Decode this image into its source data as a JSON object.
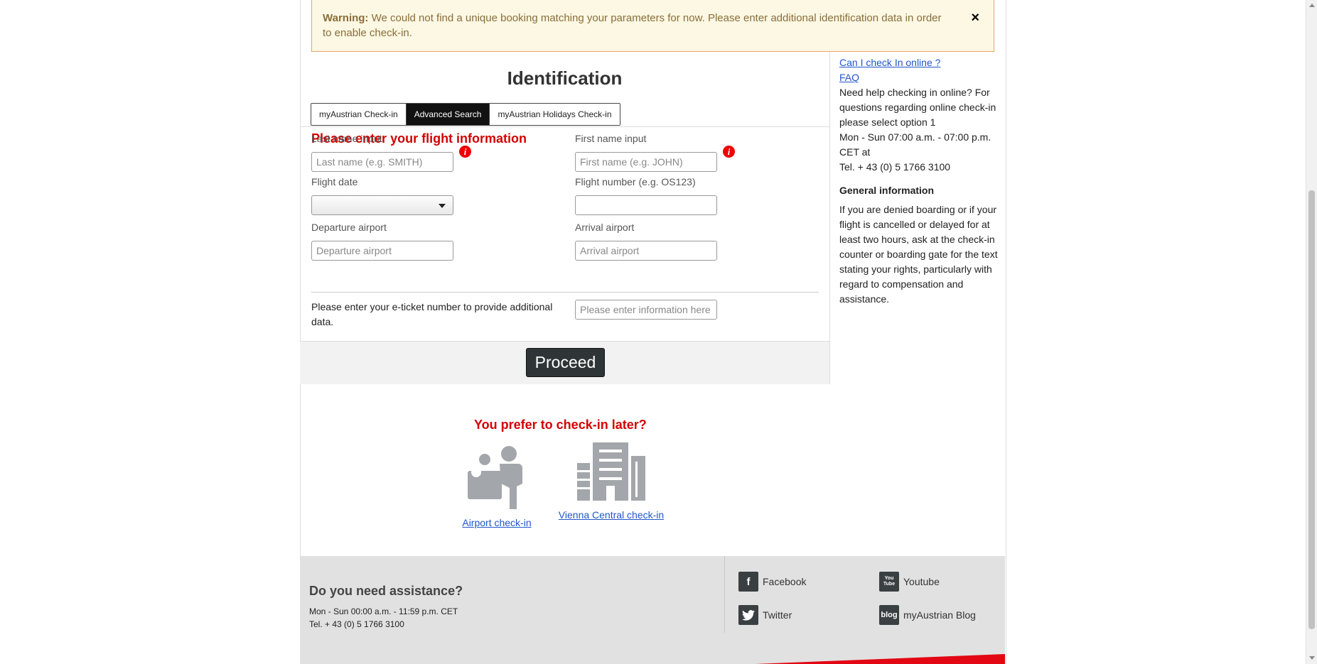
{
  "warning": {
    "prefix": "Warning:",
    "message": "We could not find a unique booking matching your parameters for now. Please enter additional identification data in order to enable check-in.",
    "close_symbol": "×"
  },
  "main": {
    "title": "Identification",
    "tabs": [
      {
        "label": "myAustrian Check-in",
        "active": false
      },
      {
        "label": "Advanced Search",
        "active": true
      },
      {
        "label": "myAustrian Holidays Check-in",
        "active": false
      }
    ],
    "form_heading": "Please enter your flight information",
    "fields": {
      "last_name": {
        "label": "Last name input",
        "placeholder": "Last name (e.g. SMITH)",
        "value": ""
      },
      "first_name": {
        "label": "First name input",
        "placeholder": "First name (e.g. JOHN)",
        "value": ""
      },
      "flight_date": {
        "label": "Flight date",
        "value": ""
      },
      "flight_number": {
        "label": "Flight number (e.g. OS123)",
        "placeholder": "",
        "value": ""
      },
      "departure": {
        "label": "Departure airport",
        "placeholder": "Departure airport",
        "value": ""
      },
      "arrival": {
        "label": "Arrival airport",
        "placeholder": "Arrival airport",
        "value": ""
      },
      "eticket": {
        "label": "Please enter your e-ticket number to provide additional data.",
        "placeholder": "Please enter information here",
        "value": ""
      }
    },
    "info_icon_glyph": "i",
    "proceed_label": "Proceed"
  },
  "sidebar": {
    "links": [
      "Can I check In online ?",
      "FAQ"
    ],
    "help_text": "Need help checking in online? For questions regarding online check-in please select option 1",
    "hours": "Mon - Sun 07:00 a.m. - 07:00 p.m. CET at",
    "phone": "Tel. + 43 (0) 5 1766 3100",
    "general_heading": "General information",
    "general_text": "If you are denied boarding or if your flight is cancelled or delayed for at least two hours, ask at the check-in counter or boarding gate for the text stating your rights, particularly with regard to compensation and assistance."
  },
  "later": {
    "heading": "You prefer to check-in later?",
    "options": [
      {
        "label": "Airport check-in",
        "icon": "airport-people-icon"
      },
      {
        "label": "Vienna Central check-in",
        "icon": "city-building-icon"
      }
    ]
  },
  "footer": {
    "assist_title": "Do you need assistance?",
    "assist_hours": "Mon - Sun 00:00 a.m. - 11:59 p.m. CET",
    "assist_phone": "Tel. + 43 (0) 5 1766 3100",
    "social": [
      {
        "label": "Facebook",
        "glyph": "f"
      },
      {
        "label": "Youtube",
        "glyph": "You Tube"
      },
      {
        "label": "Twitter",
        "glyph": "twitter-bird"
      },
      {
        "label": "myAustrian Blog",
        "glyph": "blog"
      }
    ]
  },
  "colors": {
    "accent_red": "#d40000",
    "warning_bg": "#fcf8e3",
    "link_blue": "#2255cc"
  }
}
